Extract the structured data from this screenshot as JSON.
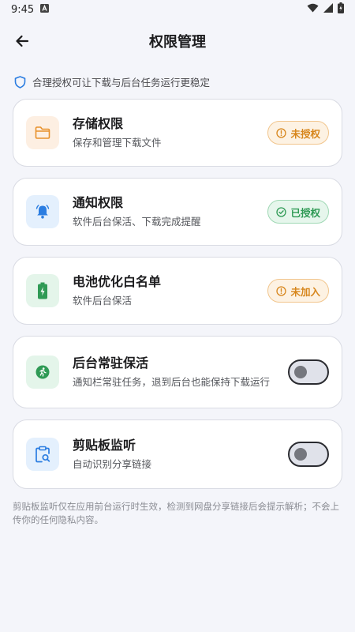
{
  "status": {
    "time": "9:45"
  },
  "header": {
    "title": "权限管理"
  },
  "notice": {
    "text": "合理授权可让下载与后台任务运行更稳定"
  },
  "cards": [
    {
      "title": "存储权限",
      "desc": "保存和管理下载文件",
      "badge": "未授权",
      "icon": "folder-icon",
      "accent": "#e8912a"
    },
    {
      "title": "通知权限",
      "desc": "软件后台保活、下载完成提醒",
      "badge": "已授权",
      "icon": "bell-icon",
      "accent": "#2b7de1"
    },
    {
      "title": "电池优化白名单",
      "desc": "软件后台保活",
      "badge": "未加入",
      "icon": "battery-icon",
      "accent": "#2f9a55"
    },
    {
      "title": "后台常驻保活",
      "desc": "通知栏常驻任务，退到后台也能保持下载运行",
      "toggle": false,
      "icon": "running-icon",
      "accent": "#2f9a55"
    },
    {
      "title": "剪贴板监听",
      "desc": "自动识别分享链接",
      "toggle": false,
      "icon": "clipboard-search-icon",
      "accent": "#2b7de1"
    }
  ],
  "footer": {
    "text": "剪贴板监听仅在应用前台运行时生效，检测到网盘分享链接后会提示解析；不会上传你的任何隐私内容。"
  },
  "colors": {
    "background": "#f4f5fa",
    "warn": "#d7861c",
    "ok": "#2f9a55",
    "blue": "#2b7de1"
  }
}
